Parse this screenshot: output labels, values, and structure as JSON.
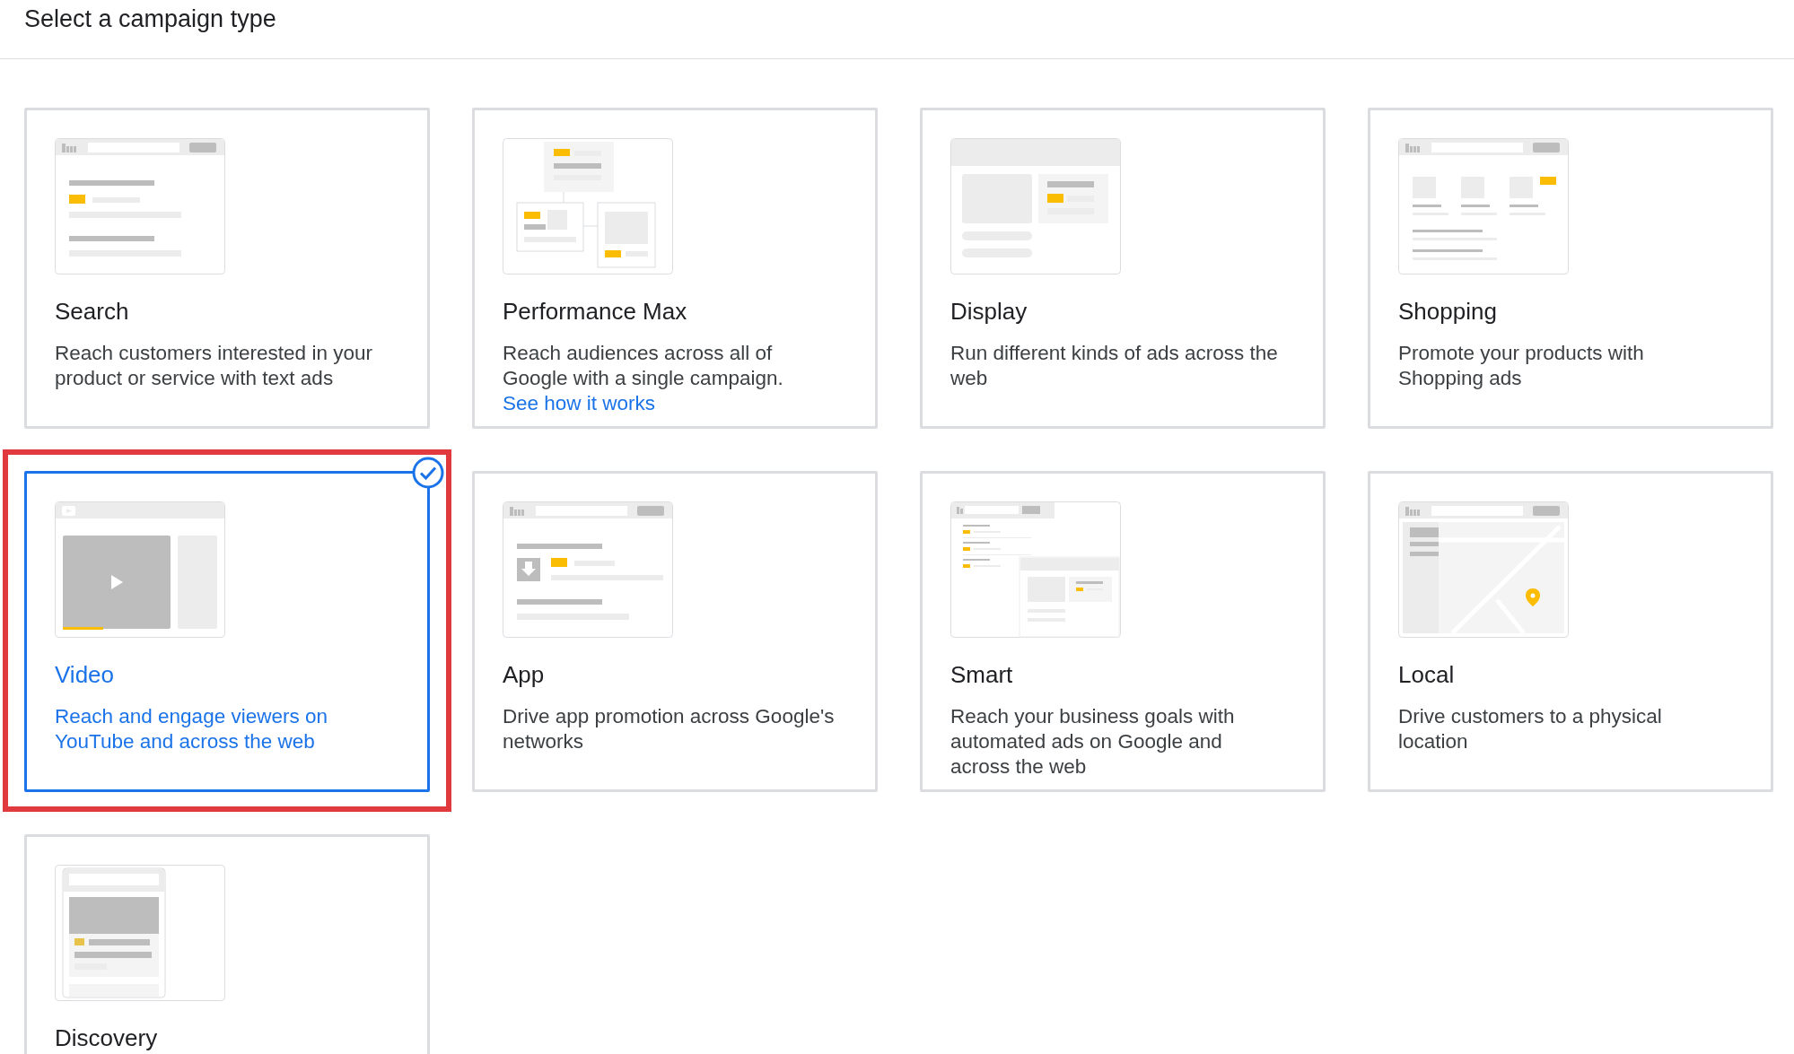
{
  "header": {
    "title": "Select a campaign type"
  },
  "campaign_types": [
    {
      "kind": "search",
      "title": "Search",
      "description": "Reach customers interested in your product or service with text ads",
      "selected": false
    },
    {
      "kind": "pmax",
      "title": "Performance Max",
      "description": "Reach audiences across all of Google with a single campaign.",
      "link": "See how it works",
      "selected": false
    },
    {
      "kind": "display",
      "title": "Display",
      "description": "Run different kinds of ads across the web",
      "selected": false
    },
    {
      "kind": "shopping",
      "title": "Shopping",
      "description": "Promote your products with Shopping ads",
      "selected": false
    },
    {
      "kind": "video",
      "title": "Video",
      "description": "Reach and engage viewers on YouTube and across the web",
      "selected": true
    },
    {
      "kind": "app",
      "title": "App",
      "description": "Drive app promotion across Google's networks",
      "selected": false
    },
    {
      "kind": "smart",
      "title": "Smart",
      "description": "Reach your business goals with automated ads on Google and across the web",
      "selected": false
    },
    {
      "kind": "local",
      "title": "Local",
      "description": "Drive customers to a physical location",
      "selected": false
    },
    {
      "kind": "discovery",
      "title": "Discovery",
      "selected": false
    }
  ]
}
